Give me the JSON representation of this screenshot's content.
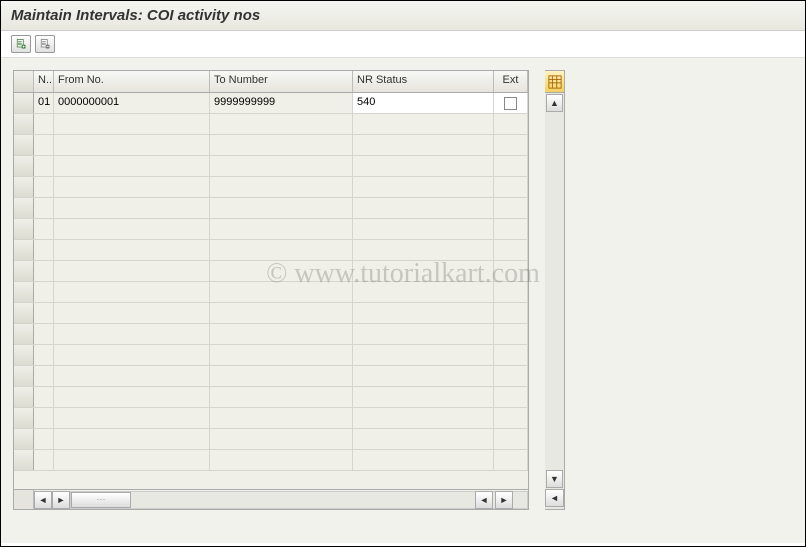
{
  "title": "Maintain Intervals: COI activity nos",
  "toolbar": {
    "btn1_name": "insert-interval-icon",
    "btn2_name": "delete-interval-icon"
  },
  "grid": {
    "headers": {
      "n": "N..",
      "from": "From No.",
      "to": "To Number",
      "nr": "NR Status",
      "ext": "Ext"
    },
    "rows": [
      {
        "n": "01",
        "from": "0000000001",
        "to": "9999999999",
        "nr": "540",
        "ext": false
      }
    ],
    "empty_row_count": 17
  },
  "watermark": "© www.tutorialkart.com"
}
